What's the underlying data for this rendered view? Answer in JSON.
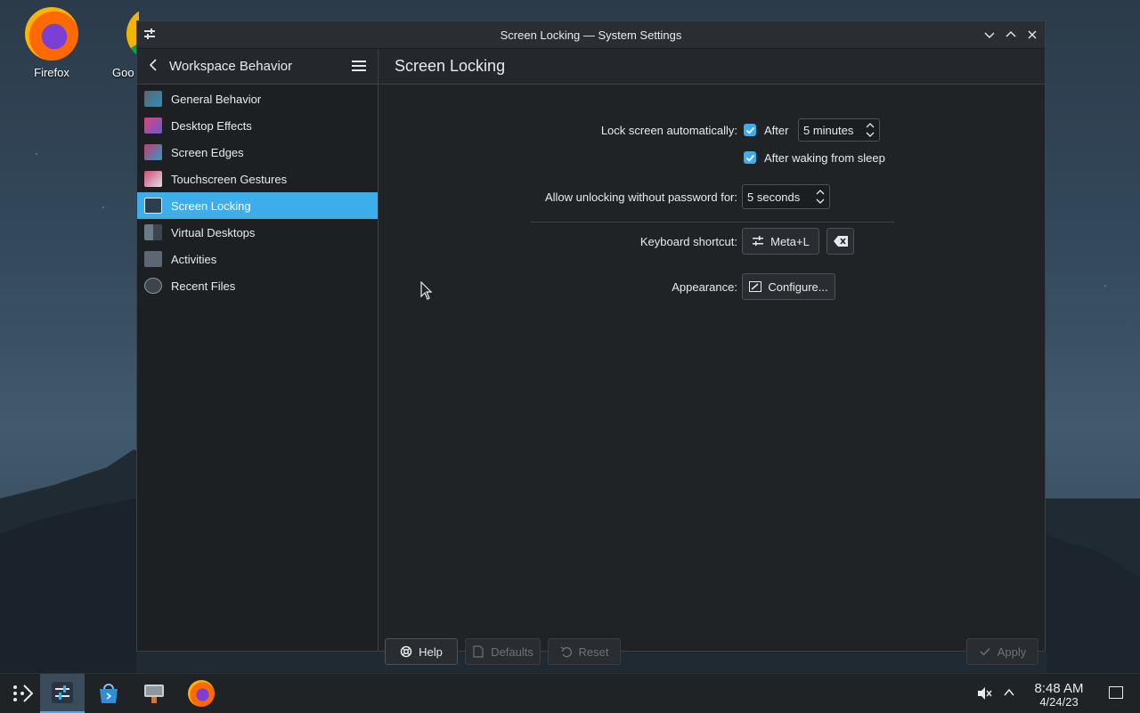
{
  "desktop": {
    "icons": [
      {
        "label": "Firefox"
      },
      {
        "label": "Goo"
      }
    ]
  },
  "window": {
    "title": "Screen Locking — System Settings"
  },
  "sidebar": {
    "header_title": "Workspace Behavior",
    "items": [
      {
        "label": "General Behavior",
        "icon": "general-behavior-icon"
      },
      {
        "label": "Desktop Effects",
        "icon": "desktop-effects-icon"
      },
      {
        "label": "Screen Edges",
        "icon": "screen-edges-icon"
      },
      {
        "label": "Touchscreen Gestures",
        "icon": "touchscreen-gestures-icon"
      },
      {
        "label": "Screen Locking",
        "icon": "screen-locking-icon",
        "active": true
      },
      {
        "label": "Virtual Desktops",
        "icon": "virtual-desktops-icon"
      },
      {
        "label": "Activities",
        "icon": "activities-icon"
      },
      {
        "label": "Recent Files",
        "icon": "recent-files-icon"
      }
    ]
  },
  "page": {
    "title": "Screen Locking",
    "lock_auto_label": "Lock screen automatically:",
    "after_label": "After",
    "after_checked": true,
    "after_value": "5 minutes",
    "after_waking_label": "After waking from sleep",
    "after_waking_checked": true,
    "unlock_label": "Allow unlocking without password for:",
    "unlock_value": "5 seconds",
    "shortcut_label": "Keyboard shortcut:",
    "shortcut_value": "Meta+L",
    "appearance_label": "Appearance:",
    "configure_label": "Configure..."
  },
  "footer": {
    "help": "Help",
    "defaults": "Defaults",
    "reset": "Reset",
    "apply": "Apply"
  },
  "taskbar": {
    "time": "8:48 AM",
    "date": "4/24/23"
  },
  "colors": {
    "accent": "#3daee9",
    "window_bg": "#202326",
    "sidebar_bg": "#1d2023"
  }
}
